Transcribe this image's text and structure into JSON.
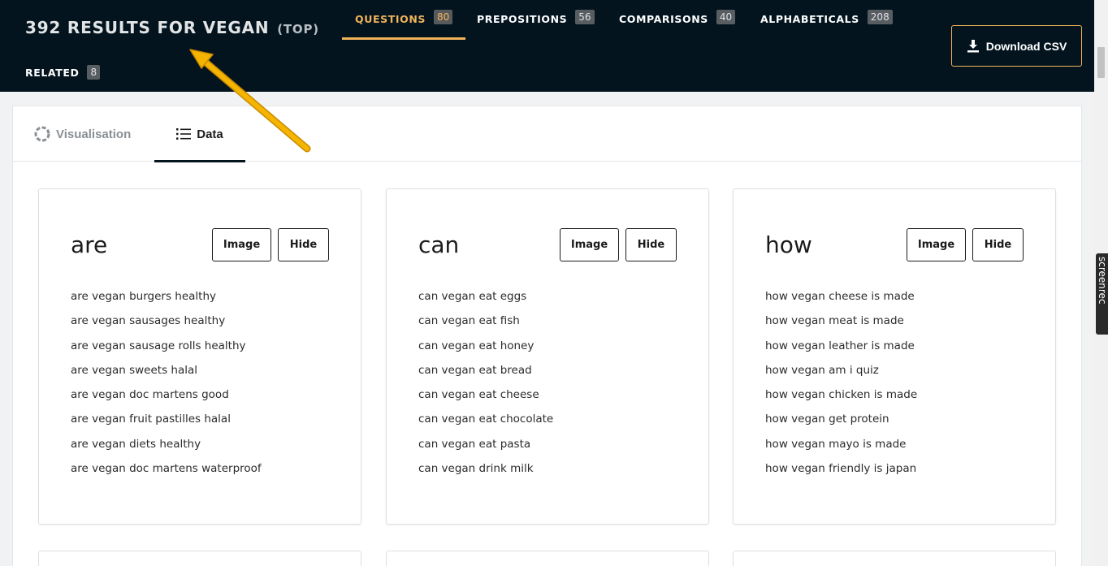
{
  "header": {
    "results_title": "392 RESULTS FOR VEGAN",
    "results_scope": "(TOP)",
    "tabs": [
      {
        "label": "QUESTIONS",
        "count": "80"
      },
      {
        "label": "PREPOSITIONS",
        "count": "56"
      },
      {
        "label": "COMPARISONS",
        "count": "40"
      },
      {
        "label": "ALPHABETICALS",
        "count": "208"
      }
    ],
    "related": {
      "label": "RELATED",
      "count": "8"
    },
    "download_label": "Download CSV"
  },
  "view_tabs": {
    "visualisation": "Visualisation",
    "data": "Data"
  },
  "cards": [
    {
      "title": "are",
      "image_label": "Image",
      "hide_label": "Hide",
      "items": [
        "are vegan burgers healthy",
        "are vegan sausages healthy",
        "are vegan sausage rolls healthy",
        "are vegan sweets halal",
        "are vegan doc martens good",
        "are vegan fruit pastilles halal",
        "are vegan diets healthy",
        "are vegan doc martens waterproof"
      ]
    },
    {
      "title": "can",
      "image_label": "Image",
      "hide_label": "Hide",
      "items": [
        "can vegan eat eggs",
        "can vegan eat fish",
        "can vegan eat honey",
        "can vegan eat bread",
        "can vegan eat cheese",
        "can vegan eat chocolate",
        "can vegan eat pasta",
        "can vegan drink milk"
      ]
    },
    {
      "title": "how",
      "image_label": "Image",
      "hide_label": "Hide",
      "items": [
        "how vegan cheese is made",
        "how vegan meat is made",
        "how vegan leather is made",
        "how vegan am i quiz",
        "how vegan chicken is made",
        "how vegan get protein",
        "how vegan mayo is made",
        "how vegan friendly is japan"
      ]
    }
  ],
  "watermark": "screenrec",
  "colors": {
    "header_bg": "#03141f",
    "accent": "#f1b35a",
    "arrow": "#f4b400"
  }
}
